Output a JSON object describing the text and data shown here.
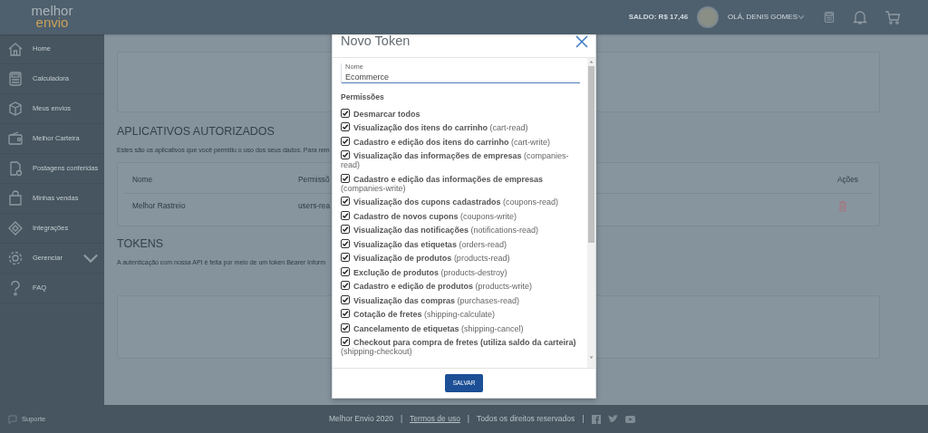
{
  "header": {
    "logo": [
      "melhor",
      "envio"
    ],
    "balance": "SALDO: R$ 17,46",
    "greeting": "OLÁ, DENIS GOMES"
  },
  "sidebar": {
    "items": [
      {
        "label": "Home",
        "expandable": false
      },
      {
        "label": "Calculadora",
        "expandable": false
      },
      {
        "label": "Meus envios",
        "expandable": false
      },
      {
        "label": "Melhor Carteira",
        "expandable": false
      },
      {
        "label": "Postagens conferidas",
        "expandable": false
      },
      {
        "label": "Minhas vendas",
        "expandable": false
      },
      {
        "label": "Integrações",
        "expandable": false
      },
      {
        "label": "Gerenciar",
        "expandable": true
      },
      {
        "label": "FAQ",
        "expandable": false
      }
    ],
    "support": "Suporte"
  },
  "main": {
    "apps_title": "APLICATIVOS AUTORIZADOS",
    "apps_text": "Estes são os aplicativos que você permitiu o uso dos seus dados. Para rem",
    "table": {
      "columns": [
        "Nome",
        "Permissõ",
        "Ações"
      ],
      "rows": [
        [
          "Melhor Rastreio",
          "users-rea"
        ]
      ]
    },
    "tokens_title": "TOKENS",
    "tokens_text": "A autenticação com nossa API é feita por meio de um token Bearer Inform"
  },
  "modal": {
    "title": "Novo Token",
    "field": {
      "label": "Nome",
      "value": "Ecommerce"
    },
    "section": "Permissões",
    "permissions": [
      {
        "label": "Desmarcar todos",
        "checked": true
      },
      {
        "label": "Visualização dos itens do carrinho",
        "scope": "(cart-read)",
        "checked": true
      },
      {
        "label": "Cadastro e edição dos itens do carrinho",
        "scope": "(cart-write)",
        "checked": true
      },
      {
        "label": "Visualização das informações de empresas",
        "scope": "(companies-read)",
        "checked": true
      },
      {
        "label": "Cadastro e edição das informações de empresas",
        "scope": "(companies-write)",
        "checked": true
      },
      {
        "label": "Visualização dos cupons cadastrados",
        "scope": "(coupons-read)",
        "checked": true
      },
      {
        "label": "Cadastro de novos cupons",
        "scope": "(coupons-write)",
        "checked": true
      },
      {
        "label": "Visualização das notificações",
        "scope": "(notifications-read)",
        "checked": true
      },
      {
        "label": "Visualização das etiquetas",
        "scope": "(orders-read)",
        "checked": true
      },
      {
        "label": "Visualização de produtos",
        "scope": "(products-read)",
        "checked": true
      },
      {
        "label": "Exclução de produtos",
        "scope": "(products-destroy)",
        "checked": true
      },
      {
        "label": "Cadastro e edição de produtos",
        "scope": "(products-write)",
        "checked": true
      },
      {
        "label": "Visualização das compras",
        "scope": "(purchases-read)",
        "checked": true
      },
      {
        "label": "Cotação de fretes",
        "scope": "(shipping-calculate)",
        "checked": true
      },
      {
        "label": "Cancelamento de etiquetas",
        "scope": "(shipping-cancel)",
        "checked": true
      },
      {
        "label": "Checkout para compra de fretes (utiliza saldo da carteira)",
        "scope": "(shipping-checkout)",
        "checked": true
      }
    ],
    "save_button": "SALVAR"
  },
  "footer": {
    "copyright": "Melhor Envio 2020",
    "separator_1": "|",
    "terms_link": "Termos de uso",
    "separator_2": "|",
    "rights": "Todos os direitos reservados",
    "separator_3": "|"
  }
}
